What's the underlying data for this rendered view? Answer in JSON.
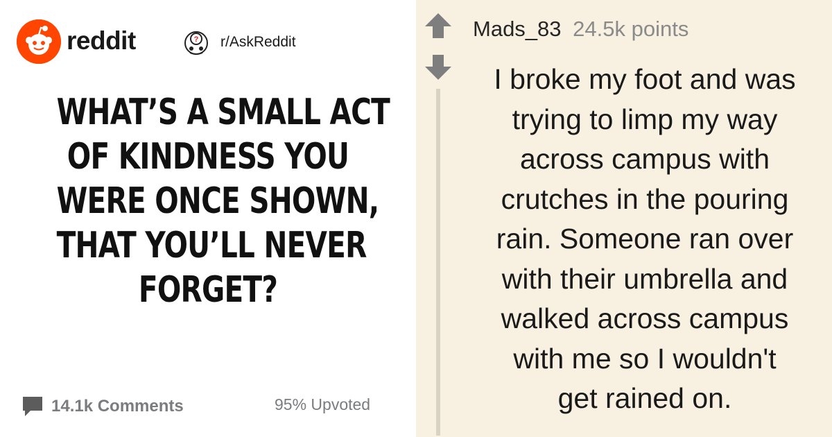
{
  "header": {
    "brand": "reddit",
    "subreddit": "r/AskReddit"
  },
  "post": {
    "title_lines": [
      "WHAT’S A SMALL ACT",
      "OF KINDNESS YOU",
      "WERE ONCE SHOWN,",
      "THAT YOU’LL NEVER",
      "FORGET?"
    ],
    "comments_label": "14.1k Comments",
    "upvoted_label": "95% Upvoted"
  },
  "comment": {
    "username": "Mads_83",
    "points": "24.5k points",
    "body_lines": [
      "I broke my foot and was",
      "trying to limp my way",
      "across campus with",
      "crutches in the pouring",
      "rain. Someone ran over",
      "with their umbrella and",
      "walked across campus",
      "with me so I wouldn't",
      "get rained on."
    ]
  },
  "icons": {
    "brand_logo": "reddit-alien-logo",
    "subreddit_icon": "askreddit-snoo-icon",
    "comments_icon": "speech-bubble-icon",
    "upvote_icon": "up-arrow-icon",
    "downvote_icon": "down-arrow-icon"
  },
  "colors": {
    "brand_orange": "#ff4500",
    "panel_background": "#f8f1e1",
    "arrow_gray": "#7e7e7e",
    "meta_gray": "#7a7c7e"
  }
}
